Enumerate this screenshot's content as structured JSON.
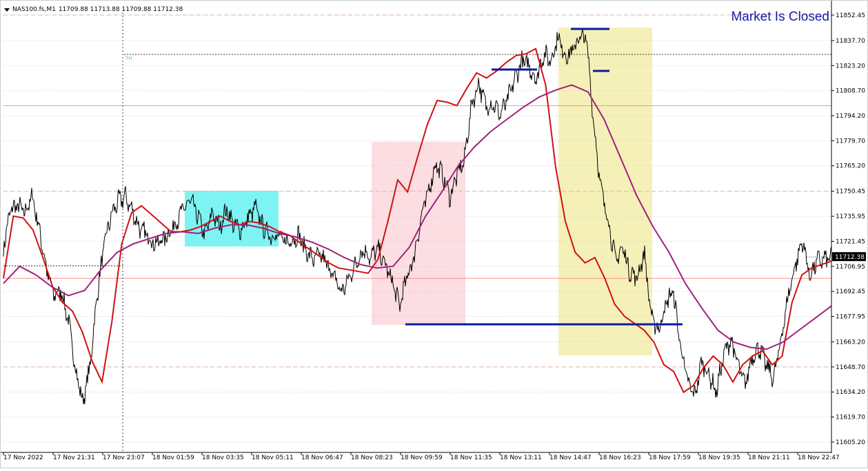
{
  "header": {
    "symbol": "NAS100.fs,M1",
    "ohlc": "11709.88 11713.88 11709.88 11712.38"
  },
  "notice": "Market Is Closed",
  "period_marker": "TH",
  "current_price_label": "11712.38",
  "colors": {
    "price_bars": "#000000",
    "fast_ma": "#d01010",
    "slow_ma": "#a0207a",
    "level_lines": "#ff9090",
    "blue_lines": "#0a1aa0",
    "cyan_box": "#7ef3f3",
    "pink_box": "#fbdde2",
    "yellow_box": "#f5f0b8"
  },
  "chart_data": {
    "type": "line",
    "y_ticks": [
      "11852.45",
      "11837.70",
      "11823.20",
      "11808.70",
      "11794.20",
      "11779.70",
      "11765.20",
      "11750.45",
      "11735.95",
      "11721.45",
      "11706.95",
      "11692.45",
      "11677.95",
      "11663.20",
      "11648.70",
      "11634.20",
      "11619.70",
      "11605.20"
    ],
    "x_ticks": [
      "17 Nov 2022",
      "17 Nov 21:31",
      "17 Nov 23:07",
      "18 Nov 01:59",
      "18 Nov 03:35",
      "18 Nov 05:11",
      "18 Nov 06:47",
      "18 Nov 08:23",
      "18 Nov 09:59",
      "18 Nov 11:35",
      "18 Nov 13:11",
      "18 Nov 14:47",
      "18 Nov 16:23",
      "18 Nov 17:59",
      "18 Nov 19:35",
      "18 Nov 21:11",
      "18 Nov 22:47"
    ],
    "ylim": [
      11600,
      11858
    ],
    "grid": true,
    "series": [
      {
        "values": [
          11718,
          11740,
          11742,
          11738,
          11748,
          11728,
          11705,
          11690,
          11693,
          11676,
          11648,
          11628,
          11648,
          11690,
          11720,
          11737,
          11745,
          11747,
          11738,
          11728,
          11725,
          11720,
          11722,
          11726,
          11733,
          11740,
          11745,
          11736,
          11725,
          11738,
          11730,
          11740,
          11731,
          11728,
          11735,
          11741,
          11730,
          11725,
          11725,
          11721,
          11722,
          11725,
          11716,
          11711,
          11713,
          11708,
          11700,
          11692,
          11700,
          11709,
          11717,
          11712,
          11717,
          11708,
          11698,
          11684,
          11700,
          11712,
          11735,
          11750,
          11766,
          11760,
          11747,
          11760,
          11768,
          11800,
          11813,
          11800,
          11801,
          11795,
          11803,
          11815,
          11826,
          11823,
          11815,
          11830,
          11826,
          11840,
          11829,
          11831,
          11840,
          11838,
          11789,
          11751,
          11734,
          11710,
          11718,
          11704,
          11700,
          11715,
          11677,
          11670,
          11685,
          11693,
          11662,
          11640,
          11632,
          11652,
          11644,
          11634,
          11655,
          11665,
          11650,
          11638,
          11655,
          11660,
          11649,
          11642,
          11665,
          11690,
          11708,
          11722,
          11701,
          11710,
          11711,
          11712
        ]
      },
      {
        "values": [
          11700,
          11736,
          11735,
          11728,
          11712,
          11695,
          11686,
          11681,
          11669,
          11652,
          11640,
          11675,
          11720,
          11738,
          11742,
          11737,
          11732,
          11727,
          11727,
          11728,
          11730,
          11733,
          11736,
          11733,
          11731,
          11733,
          11732,
          11730,
          11727,
          11725,
          11721,
          11717,
          11713,
          11709,
          11706,
          11705,
          11704,
          11703,
          11711,
          11733,
          11757,
          11750,
          11770,
          11789,
          11803,
          11802,
          11800,
          11810,
          11819,
          11816,
          11820,
          11825,
          11829,
          11830,
          11833,
          11812,
          11765,
          11733,
          11715,
          11709,
          11712,
          11700,
          11685,
          11678,
          11674,
          11670,
          11663,
          11650,
          11646,
          11634,
          11638,
          11648,
          11655,
          11650,
          11640,
          11650,
          11655,
          11658,
          11650,
          11655,
          11686,
          11702,
          11706,
          11708,
          11710
        ]
      },
      {
        "values": [
          11697,
          11707,
          11702,
          11695,
          11690,
          11693,
          11705,
          11715,
          11720,
          11723,
          11726,
          11727,
          11726,
          11729,
          11731,
          11731,
          11729,
          11726,
          11724,
          11721,
          11717,
          11712,
          11708,
          11706,
          11707,
          11718,
          11736,
          11750,
          11765,
          11776,
          11785,
          11792,
          11799,
          11805,
          11809,
          11812,
          11808,
          11792,
          11770,
          11748,
          11730,
          11715,
          11697,
          11683,
          11670,
          11663,
          11660,
          11659,
          11663,
          11670,
          11677,
          11684
        ]
      }
    ]
  }
}
